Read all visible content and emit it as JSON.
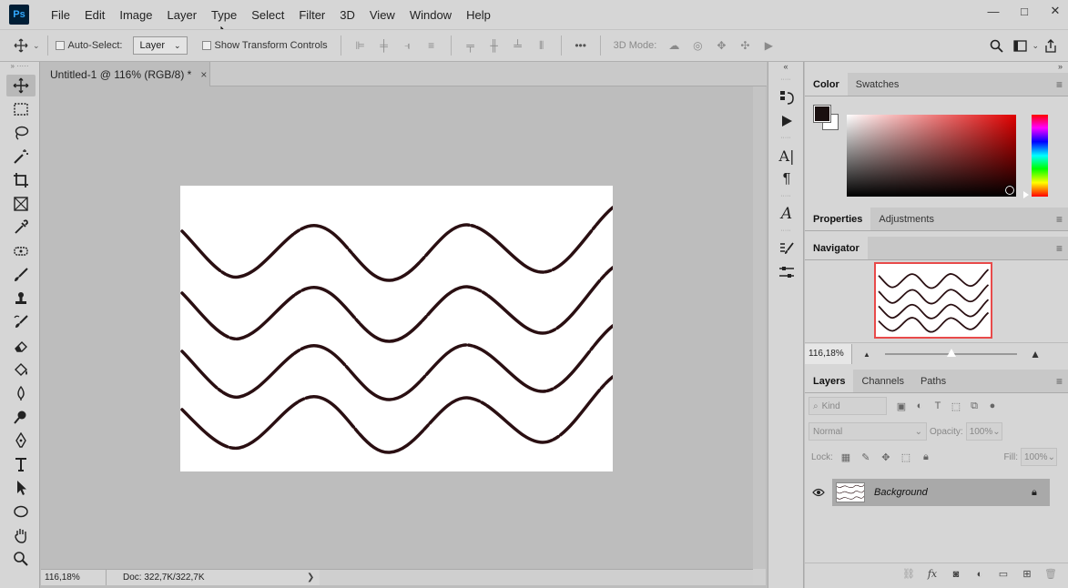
{
  "app": {
    "logo_text": "Ps"
  },
  "menu": [
    "File",
    "Edit",
    "Image",
    "Layer",
    "Type",
    "Select",
    "Filter",
    "3D",
    "View",
    "Window",
    "Help"
  ],
  "window_controls": {
    "minimize": "—",
    "maximize": "□",
    "close": "✕"
  },
  "options": {
    "auto_select_label": "Auto-Select:",
    "auto_select_target": "Layer",
    "show_transform_label": "Show Transform Controls",
    "mode_3d_label": "3D Mode:",
    "more": "•••"
  },
  "document": {
    "tab_title": "Untitled-1 @ 116% (RGB/8) *",
    "tab_close": "×",
    "zoom": "116,18%",
    "doc_info": "Doc: 322,7K/322,7K",
    "status_arrow": "❯"
  },
  "panels": {
    "color_tabs": [
      "Color",
      "Swatches"
    ],
    "properties_tabs": [
      "Properties",
      "Adjustments"
    ],
    "navigator_tab": "Navigator",
    "navigator_zoom": "116,18%",
    "layers_tabs": [
      "Layers",
      "Channels",
      "Paths"
    ],
    "colors": {
      "foreground": "#1a1010",
      "background": "#ffffff",
      "hue": "#e00000"
    }
  },
  "layers": {
    "kind_placeholder": "Kind",
    "blend_mode": "Normal",
    "opacity_label": "Opacity:",
    "opacity_value": "100%",
    "lock_label": "Lock:",
    "fill_label": "Fill:",
    "fill_value": "100%",
    "items": [
      {
        "name": "Background",
        "visible": true,
        "locked": true
      }
    ]
  }
}
